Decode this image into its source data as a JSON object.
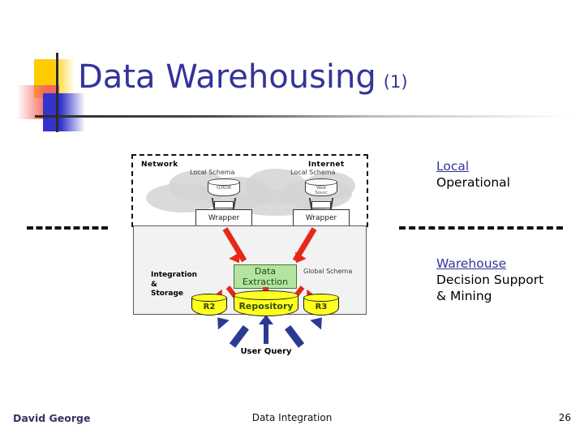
{
  "slide": {
    "title_main": "Data Warehousing",
    "title_suffix": "(1)"
  },
  "annotations": {
    "local_heading": "Local",
    "local_body": "Operational",
    "warehouse_heading": "Warehouse",
    "warehouse_body_line1": "Decision Support",
    "warehouse_body_line2": "& Mining"
  },
  "diagram": {
    "zone_network": "Network",
    "zone_internet": "Internet",
    "local_schema_left": "Local Schema",
    "local_schema_right": "Local Schema",
    "source_db_left": "O/RDB",
    "source_db_right_line1": "Web",
    "source_db_right_line2": "Sourc",
    "wrapper_left": "Wrapper",
    "wrapper_right": "Wrapper",
    "data_extraction_line1": "Data",
    "data_extraction_line2": "Extraction",
    "global_schema": "Global Schema",
    "integration_storage": "Integration\n&\nStorage",
    "cylinder_r2": "R2",
    "cylinder_repository": "Repository",
    "cylinder_r3": "R3",
    "user_query": "User Query"
  },
  "footer": {
    "author": "David George",
    "subject": "Data Integration",
    "page_number": "26"
  },
  "colors": {
    "title_blue": "#333399",
    "logo_yellow": "#FFCC00",
    "logo_red": "#F4695E",
    "logo_blue": "#3333CC",
    "arrow_red": "#E8271B",
    "arrow_blue": "#2A3A91",
    "extraction_green": "#B5E3A0",
    "storage_yellow": "#FFFF22",
    "zone_grey": "#F2F2F2"
  }
}
